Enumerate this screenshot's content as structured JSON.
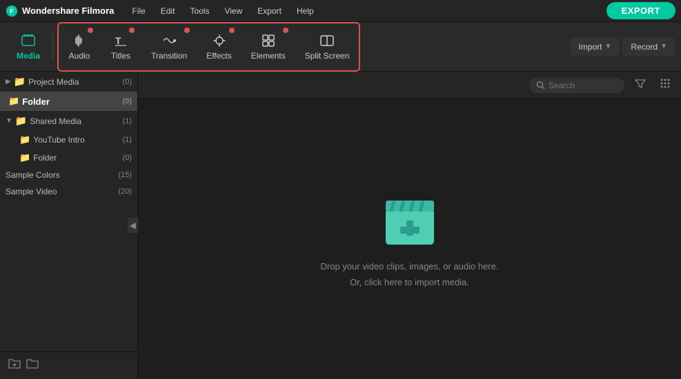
{
  "app": {
    "name": "Wondershare Filmora",
    "version": ""
  },
  "menus": {
    "items": [
      "File",
      "Edit",
      "Tools",
      "View",
      "Export",
      "Help"
    ]
  },
  "export_button": "EXPORT",
  "toolbar": {
    "media_label": "Media",
    "items": [
      {
        "id": "audio",
        "label": "Audio",
        "has_dot": true
      },
      {
        "id": "titles",
        "label": "Titles",
        "has_dot": true
      },
      {
        "id": "transition",
        "label": "Transition",
        "has_dot": true
      },
      {
        "id": "effects",
        "label": "Effects",
        "has_dot": true
      },
      {
        "id": "elements",
        "label": "Elements",
        "has_dot": true
      },
      {
        "id": "split-screen",
        "label": "Split Screen",
        "has_dot": false
      }
    ],
    "import_label": "Import",
    "record_label": "Record",
    "search_placeholder": "Search"
  },
  "sidebar": {
    "sections": [
      {
        "id": "project-media",
        "label": "Project Media",
        "count": 0,
        "children": [
          {
            "id": "folder-selected",
            "label": "Folder",
            "count": 0,
            "selected": true
          }
        ]
      },
      {
        "id": "shared-media",
        "label": "Shared Media",
        "count": 1,
        "children": [
          {
            "id": "youtube-intro",
            "label": "YouTube Intro",
            "count": 1
          },
          {
            "id": "folder-child",
            "label": "Folder",
            "count": 0
          }
        ]
      }
    ],
    "flat_items": [
      {
        "id": "sample-colors",
        "label": "Sample Colors",
        "count": 15
      },
      {
        "id": "sample-video",
        "label": "Sample Video",
        "count": 20
      }
    ],
    "footer": {
      "add_folder": "＋",
      "new_folder": "□"
    }
  },
  "media_area": {
    "drop_text_line1": "Drop your video clips, images, or audio here.",
    "drop_text_line2": "Or, click here to import media.",
    "filter_icon": "filter",
    "grid_icon": "grid"
  },
  "colors": {
    "accent": "#00c8a0",
    "red_badge": "#e05050",
    "toolbar_border": "#e05050",
    "bg_dark": "#1e1e1e",
    "bg_mid": "#252525",
    "bg_light": "#2a2a2a"
  }
}
